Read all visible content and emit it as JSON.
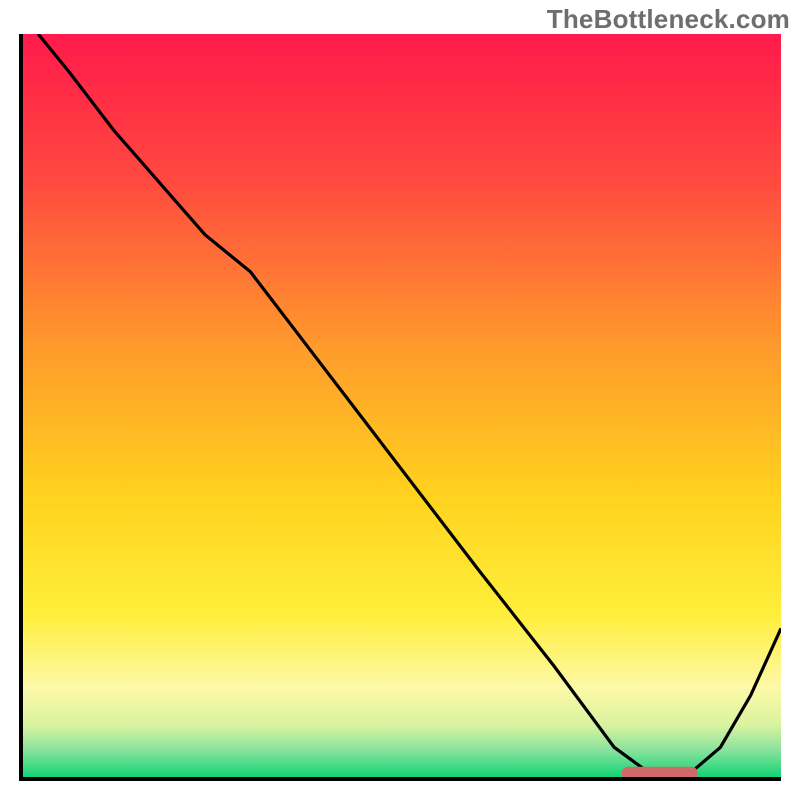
{
  "watermark": "TheBottleneck.com",
  "chart_data": {
    "type": "line",
    "title": "",
    "xlabel": "",
    "ylabel": "",
    "xlim": [
      0,
      100
    ],
    "ylim": [
      0,
      100
    ],
    "grid": false,
    "legend": "none",
    "series": [
      {
        "name": "curve",
        "x": [
          2,
          6,
          12,
          18,
          24,
          30,
          45,
          60,
          70,
          78,
          82,
          85,
          88,
          92,
          96,
          100
        ],
        "y": [
          100,
          95,
          87,
          80,
          73,
          68,
          48,
          28,
          15,
          4,
          1,
          0.5,
          0.5,
          4,
          11,
          20
        ]
      }
    ],
    "marker": {
      "name": "optimum-marker",
      "x_range": [
        79,
        89
      ],
      "y": 0.5,
      "color": "#d06a6a"
    },
    "background_gradient": {
      "type": "vertical",
      "stops": [
        {
          "pos": 0.0,
          "color": "#ff1a4b"
        },
        {
          "pos": 0.2,
          "color": "#ff4a3f"
        },
        {
          "pos": 0.42,
          "color": "#ff9a2c"
        },
        {
          "pos": 0.62,
          "color": "#ffd21e"
        },
        {
          "pos": 0.78,
          "color": "#ffee3a"
        },
        {
          "pos": 0.88,
          "color": "#fdf9a8"
        },
        {
          "pos": 0.93,
          "color": "#d9f3a0"
        },
        {
          "pos": 0.965,
          "color": "#86e29b"
        },
        {
          "pos": 1.0,
          "color": "#12d477"
        }
      ]
    }
  }
}
